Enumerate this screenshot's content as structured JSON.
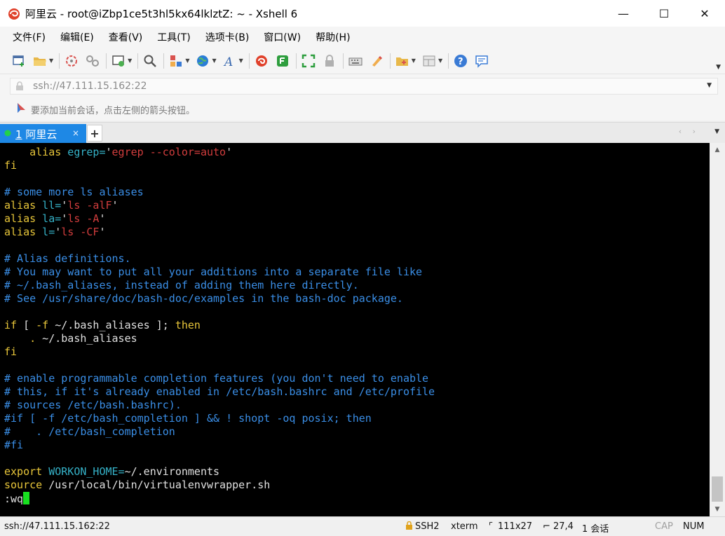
{
  "window": {
    "title": "阿里云 - root@iZbp1ce5t3hl5kx64lklztZ: ~ - Xshell 6",
    "minimize": "—",
    "maximize": "☐",
    "close": "✕"
  },
  "menu": [
    "文件(F)",
    "编辑(E)",
    "查看(V)",
    "工具(T)",
    "选项卡(B)",
    "窗口(W)",
    "帮助(H)"
  ],
  "toolbar_icons": [
    "new-session-icon",
    "open-folder-icon",
    "reconnect-icon",
    "disconnect-icon",
    "properties-icon",
    "find-icon",
    "transfer-icon",
    "globe-icon",
    "font-icon",
    "xmanager-icon",
    "xftp-icon",
    "fullscreen-icon",
    "lock-icon",
    "keyboard-icon",
    "highlight-icon",
    "compose-icon",
    "layout-icon",
    "help-icon",
    "chat-icon"
  ],
  "address": {
    "value": "ssh://47.111.15.162:22"
  },
  "hint": {
    "text": "要添加当前会话，点击左侧的箭头按钮。"
  },
  "tabs": {
    "active_num": "1",
    "active_name": " 阿里云",
    "close": "×",
    "new": "+",
    "nav": "‹ ›"
  },
  "terminal": {
    "lines": [
      {
        "parts": [
          {
            "t": "    ",
            "c": "plain"
          },
          {
            "t": "alias",
            "c": "alias"
          },
          {
            "t": " egrep=",
            "c": "var"
          },
          {
            "t": "'",
            "c": "plain"
          },
          {
            "t": "egrep --color=auto",
            "c": "str"
          },
          {
            "t": "'",
            "c": "plain"
          }
        ]
      },
      {
        "parts": [
          {
            "t": "fi",
            "c": "alias"
          }
        ]
      },
      {
        "parts": []
      },
      {
        "parts": [
          {
            "t": "# some more ls aliases",
            "c": "cmt"
          }
        ]
      },
      {
        "parts": [
          {
            "t": "alias",
            "c": "alias"
          },
          {
            "t": " ll=",
            "c": "var"
          },
          {
            "t": "'",
            "c": "plain"
          },
          {
            "t": "ls -alF",
            "c": "str"
          },
          {
            "t": "'",
            "c": "plain"
          }
        ]
      },
      {
        "parts": [
          {
            "t": "alias",
            "c": "alias"
          },
          {
            "t": " la=",
            "c": "var"
          },
          {
            "t": "'",
            "c": "plain"
          },
          {
            "t": "ls -A",
            "c": "str"
          },
          {
            "t": "'",
            "c": "plain"
          }
        ]
      },
      {
        "parts": [
          {
            "t": "alias",
            "c": "alias"
          },
          {
            "t": " l=",
            "c": "var"
          },
          {
            "t": "'",
            "c": "plain"
          },
          {
            "t": "ls -CF",
            "c": "str"
          },
          {
            "t": "'",
            "c": "plain"
          }
        ]
      },
      {
        "parts": []
      },
      {
        "parts": [
          {
            "t": "# Alias definitions.",
            "c": "cmt"
          }
        ]
      },
      {
        "parts": [
          {
            "t": "# You may want to put all your additions into a separate file like",
            "c": "cmt"
          }
        ]
      },
      {
        "parts": [
          {
            "t": "# ~/.bash_aliases, instead of adding them here directly.",
            "c": "cmt"
          }
        ]
      },
      {
        "parts": [
          {
            "t": "# See /usr/share/doc/bash-doc/examples in the bash-doc package.",
            "c": "cmt"
          }
        ]
      },
      {
        "parts": []
      },
      {
        "parts": [
          {
            "t": "if",
            "c": "alias"
          },
          {
            "t": " [ ",
            "c": "plain"
          },
          {
            "t": "-f",
            "c": "alias"
          },
          {
            "t": " ~/.bash_aliases ]; ",
            "c": "plain"
          },
          {
            "t": "then",
            "c": "alias"
          }
        ]
      },
      {
        "parts": [
          {
            "t": "    ",
            "c": "plain"
          },
          {
            "t": ".",
            "c": "alias"
          },
          {
            "t": " ~/.bash_aliases",
            "c": "plain"
          }
        ]
      },
      {
        "parts": [
          {
            "t": "fi",
            "c": "alias"
          }
        ]
      },
      {
        "parts": []
      },
      {
        "parts": [
          {
            "t": "# enable programmable completion features (you don't need to enable",
            "c": "cmt"
          }
        ]
      },
      {
        "parts": [
          {
            "t": "# this, if it's already enabled in /etc/bash.bashrc and /etc/profile",
            "c": "cmt"
          }
        ]
      },
      {
        "parts": [
          {
            "t": "# sources /etc/bash.bashrc).",
            "c": "cmt"
          }
        ]
      },
      {
        "parts": [
          {
            "t": "#if [ -f /etc/bash_completion ] && ! shopt -oq posix; then",
            "c": "cmt"
          }
        ]
      },
      {
        "parts": [
          {
            "t": "#    . /etc/bash_completion",
            "c": "cmt"
          }
        ]
      },
      {
        "parts": [
          {
            "t": "#fi",
            "c": "cmt"
          }
        ]
      },
      {
        "parts": []
      },
      {
        "parts": [
          {
            "t": "export",
            "c": "alias"
          },
          {
            "t": " WORKON_HOME=",
            "c": "var"
          },
          {
            "t": "~/.environments",
            "c": "plain"
          }
        ]
      },
      {
        "parts": [
          {
            "t": "source",
            "c": "alias"
          },
          {
            "t": " /usr/local/bin/virtualenvwrapper.sh",
            "c": "plain"
          }
        ]
      },
      {
        "parts": [
          {
            "t": ":wq",
            "c": "plain"
          }
        ],
        "cursor": true
      }
    ]
  },
  "status": {
    "address": "ssh://47.111.15.162:22",
    "protocol": "SSH2",
    "term": "xterm",
    "size": "111x27",
    "position": "27,4",
    "sessions": "1 会话",
    "cap": "CAP",
    "num": "NUM"
  },
  "colors": {
    "tab_active": "#1e88e5",
    "terminal_bg": "#000000",
    "keyword": "#e8c63a",
    "string": "#d23d3d",
    "comment": "#3a8ee6",
    "variable": "#35b2c8",
    "cursor": "#18e020"
  }
}
